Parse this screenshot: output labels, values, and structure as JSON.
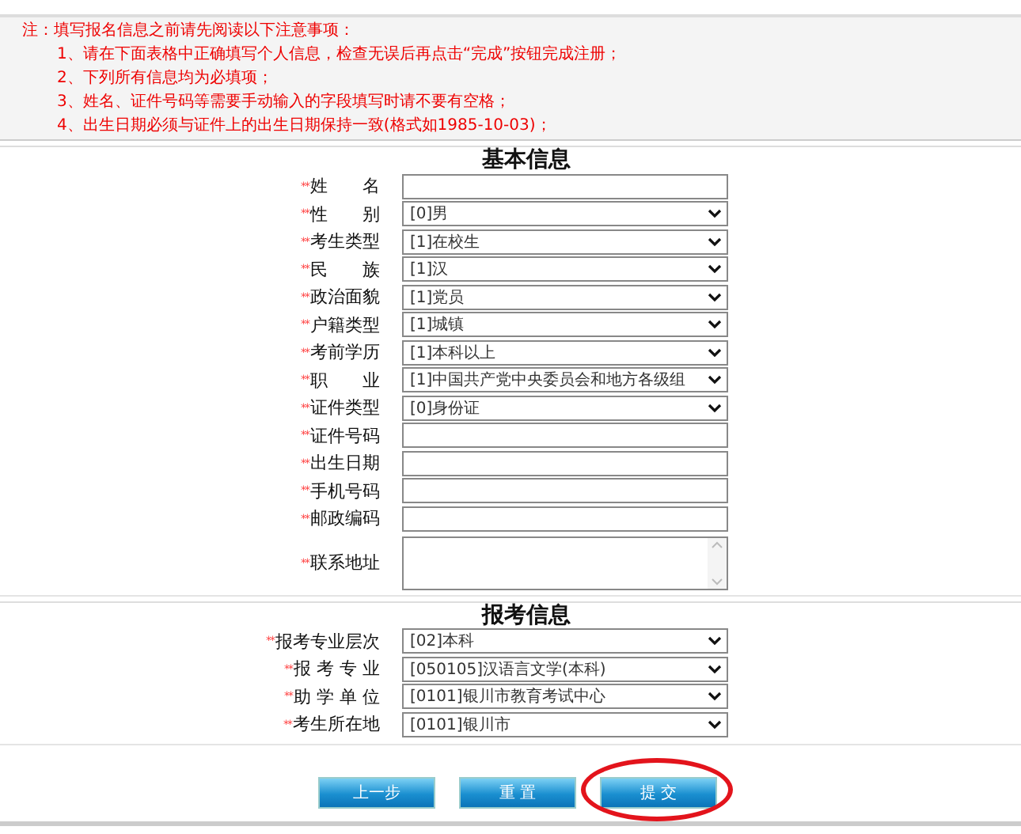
{
  "notice": {
    "title": "注：填写报名信息之前请先阅读以下注意事项：",
    "items": [
      "1、请在下面表格中正确填写个人信息，检查无误后再点击“完成”按钮完成注册；",
      "2、下列所有信息均为必填项；",
      "3、姓名、证件号码等需要手动输入的字段填写时请不要有空格；",
      "4、出生日期必须与证件上的出生日期保持一致(格式如1985-10-03)；"
    ]
  },
  "sections": [
    {
      "title": "基本信息",
      "fields": [
        {
          "mark": "**",
          "label": "姓　　名",
          "kind": "text"
        },
        {
          "mark": "**",
          "label": "性　　别",
          "kind": "select",
          "value": "[0]男"
        },
        {
          "mark": "**",
          "label": "考生类型",
          "kind": "select",
          "value": "[1]在校生"
        },
        {
          "mark": "**",
          "label": "民　　族",
          "kind": "select",
          "value": "[1]汉"
        },
        {
          "mark": "**",
          "label": "政治面貌",
          "kind": "select",
          "value": "[1]党员"
        },
        {
          "mark": "**",
          "label": "户籍类型",
          "kind": "select",
          "value": "[1]城镇"
        },
        {
          "mark": "**",
          "label": "考前学历",
          "kind": "select",
          "value": "[1]本科以上"
        },
        {
          "mark": "**",
          "label": "职　　业",
          "kind": "select",
          "value": "[1]中国共产党中央委员会和地方各级组"
        },
        {
          "mark": "**",
          "label": "证件类型",
          "kind": "select",
          "value": "[0]身份证"
        },
        {
          "mark": "**",
          "label": "证件号码",
          "kind": "text"
        },
        {
          "mark": "**",
          "label": "出生日期",
          "kind": "text"
        },
        {
          "mark": "**",
          "label": "手机号码",
          "kind": "text"
        },
        {
          "mark": "**",
          "label": "邮政编码",
          "kind": "text"
        },
        {
          "mark": "**",
          "label": "联系地址",
          "kind": "textarea"
        }
      ]
    },
    {
      "title": "报考信息",
      "fields": [
        {
          "mark": "**",
          "label": "报考专业层次",
          "kind": "select",
          "value": "[02]本科"
        },
        {
          "mark": "**",
          "label": "报 考 专 业",
          "kind": "select",
          "value": "[050105]汉语言文学(本科)"
        },
        {
          "mark": "**",
          "label": "助 学 单 位",
          "kind": "select",
          "value": "[0101]银川市教育考试中心"
        },
        {
          "mark": "**",
          "label": "考生所在地",
          "kind": "select",
          "value": "[0101]银川市"
        }
      ]
    }
  ],
  "buttons": [
    {
      "label": "上一步",
      "circled": false
    },
    {
      "label": "重 置",
      "circled": false
    },
    {
      "label": "提 交",
      "circled": true
    }
  ]
}
